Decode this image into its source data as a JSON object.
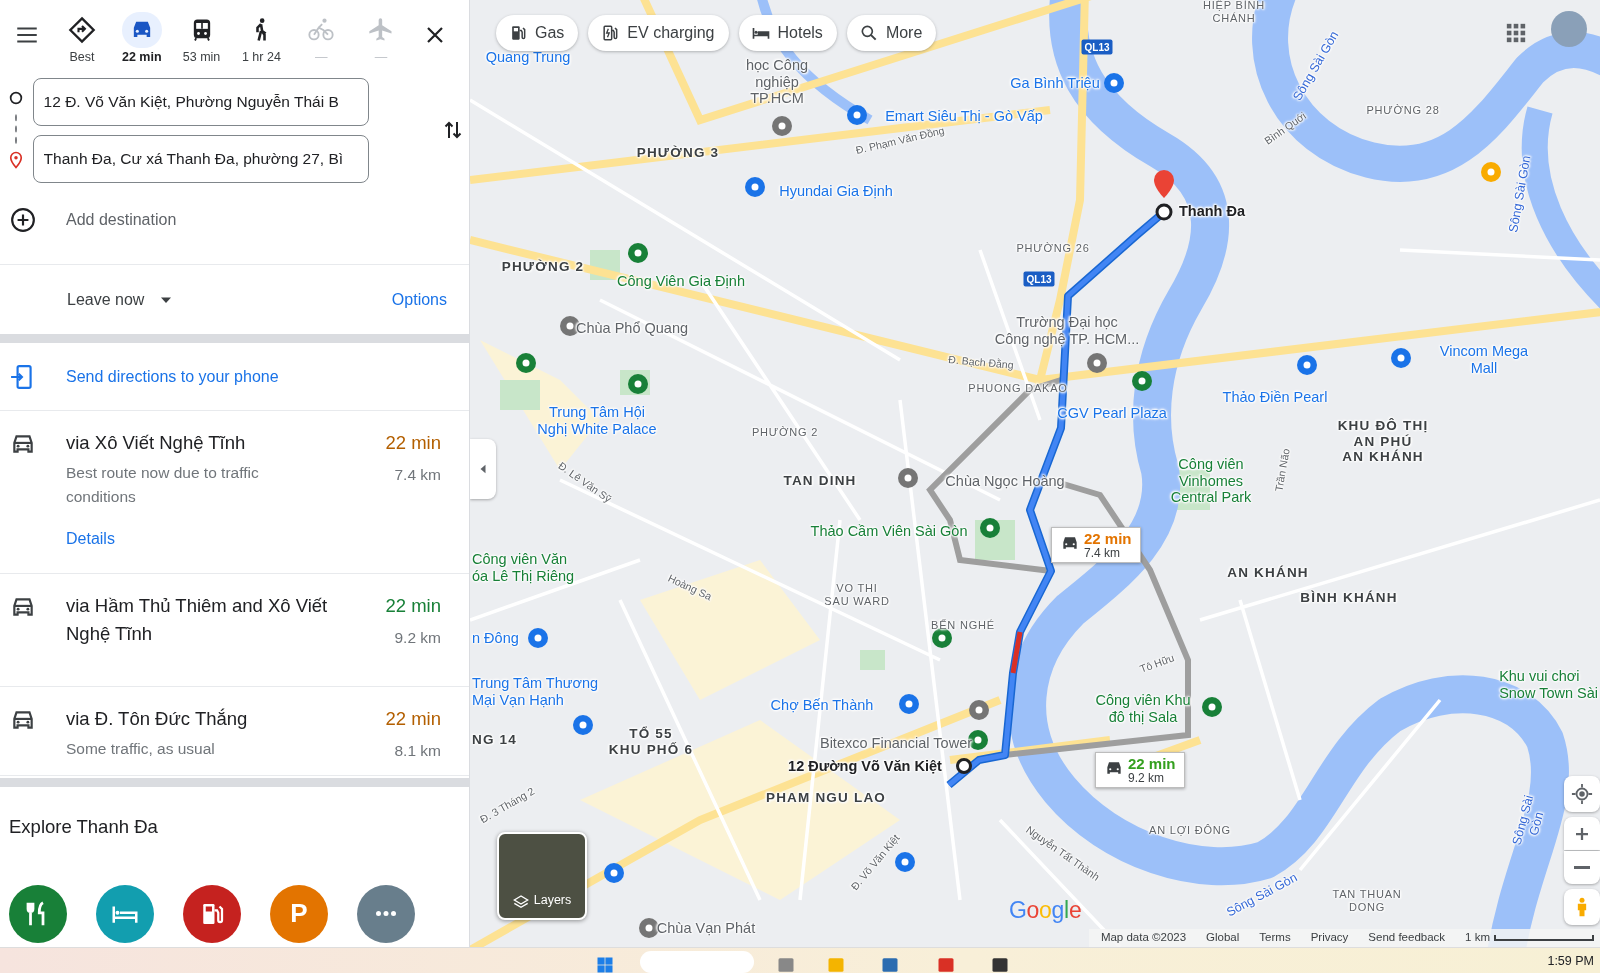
{
  "travel_modes": [
    {
      "kind": "best",
      "label": "Best",
      "selected": false,
      "disabled": false
    },
    {
      "kind": "car",
      "label": "22 min",
      "selected": true,
      "disabled": false
    },
    {
      "kind": "transit",
      "label": "53 min",
      "selected": false,
      "disabled": false
    },
    {
      "kind": "walk",
      "label": "1 hr 24",
      "selected": false,
      "disabled": false
    },
    {
      "kind": "bike",
      "label": "—",
      "selected": false,
      "disabled": true
    },
    {
      "kind": "flight",
      "label": "—",
      "selected": false,
      "disabled": true
    }
  ],
  "origin": {
    "value": "12 Đ. Võ Văn Kiệt, Phường Nguyễn Thái B"
  },
  "destination": {
    "value": "Thanh Đa, Cư xá Thanh Đa, phường 27, Bì"
  },
  "add_destination": "Add destination",
  "departure": "Leave now",
  "options_link": "Options",
  "send_to_phone": "Send directions to your phone",
  "routes": [
    {
      "title": "via Xô Viết Nghệ Tĩnh",
      "duration": "22 min",
      "distance": "7.4 km",
      "color": "#b35f00",
      "note": "Best route now due to traffic conditions",
      "details_link": "Details"
    },
    {
      "title": "via Hầm Thủ Thiêm and Xô Viết Nghệ Tĩnh",
      "duration": "22 min",
      "distance": "9.2 km",
      "color": "#188038"
    },
    {
      "title": "via Đ. Tôn Đức Thắng",
      "duration": "22 min",
      "distance": "8.1 km",
      "color": "#b35f00",
      "note": "Some traffic, as usual"
    }
  ],
  "explore": {
    "title": "Explore Thanh Đa",
    "categories": [
      {
        "kind": "restaurants",
        "color": "#188038"
      },
      {
        "kind": "hotels",
        "color": "#129eaf"
      },
      {
        "kind": "gas",
        "color": "#c5221f"
      },
      {
        "kind": "parking",
        "color": "#e37400",
        "glyph": "P"
      },
      {
        "kind": "more",
        "color": "#687e8c"
      }
    ]
  },
  "map": {
    "chips": [
      {
        "kind": "gas",
        "label": "Gas"
      },
      {
        "kind": "ev",
        "label": "EV charging"
      },
      {
        "kind": "hotels",
        "label": "Hotels"
      },
      {
        "kind": "more",
        "label": "More"
      }
    ],
    "shields": [
      "QL13",
      "QL13"
    ],
    "labels": [
      {
        "kind": "poi_blue",
        "text": "Quang Trung"
      },
      {
        "kind": "poi_gray",
        "text": "học Công\nnghiệp\nTP.HCM"
      },
      {
        "kind": "poi_blue",
        "text": "Ga Bình Triệu"
      },
      {
        "kind": "small",
        "text": "HIỆP BÌNH\nCHÁNH"
      },
      {
        "kind": "poi_blue",
        "text": "Emart Siêu Thị - Gò Vấp"
      },
      {
        "kind": "small",
        "text": "PHƯỜNG 28"
      },
      {
        "kind": "district",
        "text": "PHƯỜNG 3"
      },
      {
        "kind": "road",
        "text": "Đ. Phạm Văn Đồng"
      },
      {
        "kind": "poi_blue",
        "text": "Hyundai Gia Định"
      },
      {
        "kind": "bold",
        "text": "Thanh Đa"
      },
      {
        "kind": "small",
        "text": "PHƯỜNG 26"
      },
      {
        "kind": "road",
        "text": "Bình Quới"
      },
      {
        "kind": "district",
        "text": "PHƯỜNG 2"
      },
      {
        "kind": "poi_green",
        "text": "Công Viên Gia Định"
      },
      {
        "kind": "poi_gray",
        "text": "Chùa Phổ Quang"
      },
      {
        "kind": "poi_gray",
        "text": "Trường Đại học\nCông nghệ TP. HCM..."
      },
      {
        "kind": "road",
        "text": "Đ. Bạch Đằng"
      },
      {
        "kind": "small",
        "text": "PHUONG DAKAO"
      },
      {
        "kind": "poi_blue",
        "text": "Vincom Mega Mall"
      },
      {
        "kind": "poi_blue",
        "text": "Thảo Điền Pearl"
      },
      {
        "kind": "poi_blue",
        "text": "CGV Pearl Plaza"
      },
      {
        "kind": "poi_blue",
        "text": "Trung Tâm Hội\nNghị White Palace"
      },
      {
        "kind": "district",
        "text": "KHU ĐÔ THỊ\nAN PHÚ\nAN KHÁNH"
      },
      {
        "kind": "small",
        "text": "PHƯỜNG 2"
      },
      {
        "kind": "district",
        "text": "TAN DINH"
      },
      {
        "kind": "poi_gray",
        "text": "Chùa Ngọc Hoàng"
      },
      {
        "kind": "poi_green",
        "text": "Công viên\nVinhomes\nCentral Park"
      },
      {
        "kind": "road",
        "text": "Đ. Lê Văn Sỹ"
      },
      {
        "kind": "poi_green",
        "text": "Thảo Cầm Viên Sài Gòn"
      },
      {
        "kind": "poi_green",
        "text": "Công viên Văn\nóa Lê Thị Riêng"
      },
      {
        "kind": "district",
        "text": "AN KHÁNH"
      },
      {
        "kind": "small",
        "text": "VO THI\nSAU WARD"
      },
      {
        "kind": "district",
        "text": "BÌNH KHÁNH"
      },
      {
        "kind": "small",
        "text": "BẾN NGHÉ"
      },
      {
        "kind": "road",
        "text": "Hoàng Sa"
      },
      {
        "kind": "poi_blue",
        "text": "n Đông"
      },
      {
        "kind": "poi_blue",
        "text": "Trung Tâm Thương\nMại Vạn Hạnh"
      },
      {
        "kind": "poi_green",
        "text": "Khu vui chơi\nSnow Town Sài"
      },
      {
        "kind": "poi_blue",
        "text": "Chợ Bến Thành"
      },
      {
        "kind": "road",
        "text": "Tô Hữu"
      },
      {
        "kind": "poi_green",
        "text": "Công viên Khu\nđô thị Sala"
      },
      {
        "kind": "district",
        "text": "TỔ 55\nKHU PHỐ 6"
      },
      {
        "kind": "poi_gray",
        "text": "Bitexco Financial Tower"
      },
      {
        "kind": "bold",
        "text": "12 Đường Võ Văn Kiệt"
      },
      {
        "kind": "district",
        "text": "PHAM NGU LAO"
      },
      {
        "kind": "road",
        "text": "Đ. 3 Tháng 2"
      },
      {
        "kind": "small",
        "text": "AN LỢI ĐÔNG"
      },
      {
        "kind": "road",
        "text": "Nguyễn Tất Thành"
      },
      {
        "kind": "road",
        "text": "Đ. Võ Văn Kiệt"
      },
      {
        "kind": "small",
        "text": "TAN THUAN\nDONG"
      },
      {
        "kind": "water",
        "text": "Sông Sài Gòn"
      },
      {
        "kind": "water",
        "text": "Sông Sài Gòn"
      },
      {
        "kind": "water",
        "text": "Sông Sài Gòn"
      },
      {
        "kind": "water",
        "text": "Sông Sài Gòn"
      },
      {
        "kind": "poi_gray",
        "text": "Chùa Vạn Phát"
      },
      {
        "kind": "road",
        "text": "Trần Não"
      },
      {
        "kind": "district",
        "text": "NG 14"
      }
    ],
    "route_callouts": [
      {
        "duration": "22 min",
        "distance": "7.4 km",
        "color": "#e37400"
      },
      {
        "duration": "22 min",
        "distance": "9.2 km",
        "color": "#34a01f"
      }
    ],
    "layers_label": "Layers",
    "logo": "Google",
    "footer": [
      "Map data ©2023",
      "Global",
      "Terms",
      "Privacy",
      "Send feedback"
    ],
    "scale": "1 km"
  },
  "taskbar": {
    "clock": "1:59 PM"
  }
}
